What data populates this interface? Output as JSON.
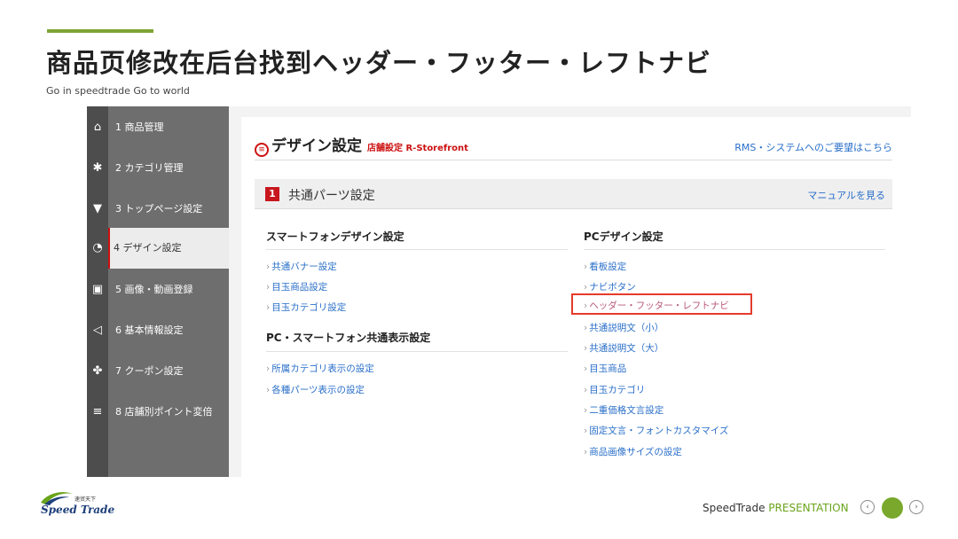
{
  "slide": {
    "title": "商品页修改在后台找到ヘッダー・フッター・レフトナビ",
    "subtitle": "Go in speedtrade Go to world",
    "accent_color": "#7fa535"
  },
  "sidebar": {
    "items": [
      {
        "icon": "home-icon",
        "glyph": "⌂",
        "label": "1 商品管理"
      },
      {
        "icon": "gear-icon",
        "glyph": "✱",
        "label": "2 カテゴリ管理"
      },
      {
        "icon": "cart-icon",
        "glyph": "▼",
        "label": "3 トップページ設定"
      },
      {
        "icon": "pie-chart-icon",
        "glyph": "◔",
        "label": "4 デザイン設定",
        "active": true
      },
      {
        "icon": "image-icon",
        "glyph": "▣",
        "label": "5 画像・動画登録"
      },
      {
        "icon": "megaphone-icon",
        "glyph": "◁",
        "label": "6 基本情報設定"
      },
      {
        "icon": "users-icon",
        "glyph": "✤",
        "label": "7 クーポン設定"
      },
      {
        "icon": "list-icon",
        "glyph": "≡",
        "label": "8 店舗別ポイント変倍"
      }
    ]
  },
  "content": {
    "design_title": "デザイン設定",
    "design_subtitle": "店舗設定 R-Storefront",
    "rms_link": "RMS・システムへのご要望はこちら",
    "section": {
      "number": "1",
      "title": "共通パーツ設定",
      "manual_link": "マニュアルを見る"
    },
    "sp_column": {
      "heading": "スマートフォンデザイン設定",
      "links": [
        "共通バナー設定",
        "目玉商品設定",
        "目玉カテゴリ設定"
      ],
      "heading2": "PC・スマートフォン共通表示設定",
      "links2": [
        "所属カテゴリ表示の設定",
        "各種パーツ表示の設定"
      ]
    },
    "pc_column": {
      "heading": "PCデザイン設定",
      "links": [
        "看板設定",
        "ナビボタン",
        "ヘッダー・フッター・レフトナビ",
        "共通説明文（小）",
        "共通説明文（大）",
        "目玉商品",
        "目玉カテゴリ",
        "二重価格文言設定",
        "固定文言・フォントカスタマイズ",
        "商品画像サイズの設定"
      ],
      "highlighted_index": 2
    },
    "link_color": "#2a6fc9",
    "highlight_color": "#e53b2c"
  },
  "footer": {
    "brand": "SpeedTrade",
    "presentation_prefix": "SpeedTrade ",
    "presentation_suffix": "PRESENTATION",
    "logo_text": "Speed Trade",
    "logo_tagline": "速贸天下",
    "prev_glyph": "‹",
    "next_glyph": "›"
  }
}
